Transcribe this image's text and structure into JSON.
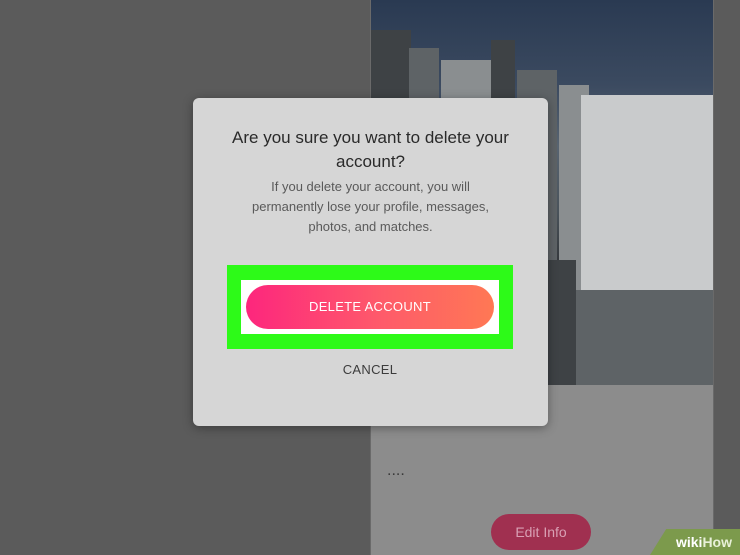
{
  "dialog": {
    "title": "Are you sure you want to delete your account?",
    "message": "If you delete your account, you will permanently lose your profile, messages, photos, and matches.",
    "delete_label": "DELETE ACCOUNT",
    "cancel_label": "CANCEL",
    "delete_gradient": [
      "#fd267d",
      "#ff7854"
    ]
  },
  "profile": {
    "bio_text": "....",
    "edit_label": "Edit Info"
  },
  "watermark": {
    "prefix": "wiki",
    "suffix": "How"
  },
  "colors": {
    "highlight": "#2dfa18",
    "dialog_bg": "#d6d6d6"
  }
}
